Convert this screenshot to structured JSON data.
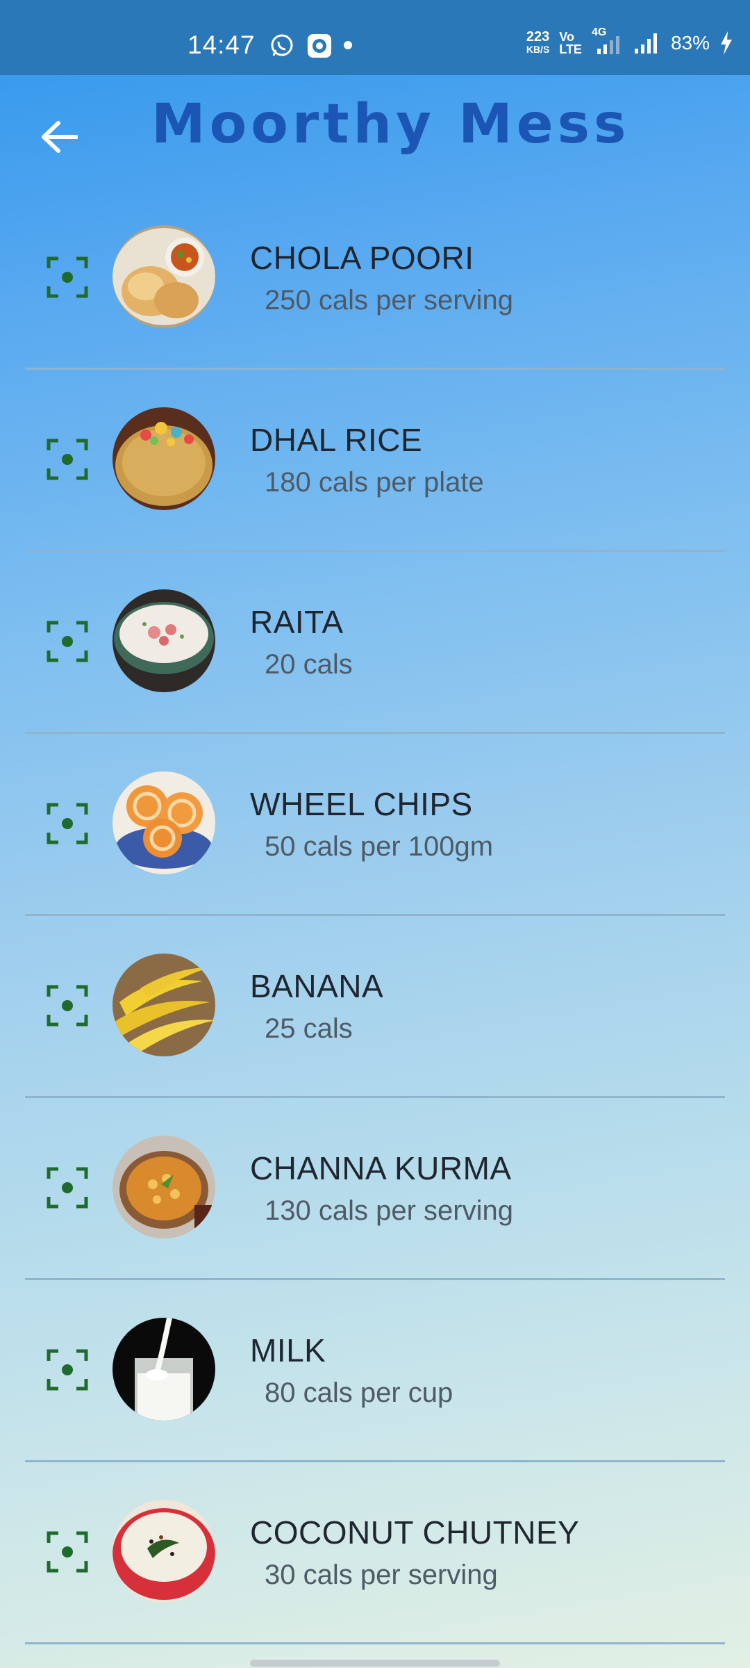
{
  "status_bar": {
    "time": "14:47",
    "net_speed_value": "223",
    "net_speed_unit": "KB/S",
    "volte_top": "Vo",
    "volte_bottom": "LTE",
    "network_type": "4G",
    "battery": "83%",
    "icons": [
      "whatsapp-icon",
      "messenger-icon",
      "notification-dot-icon",
      "signal-icon",
      "charging-icon"
    ]
  },
  "header": {
    "title": "Moorthy Mess",
    "back_icon": "arrow-left-icon"
  },
  "colors": {
    "title": "#1c56b4",
    "scan_icon": "#1f6b2e",
    "status_bar": "#2a78b8"
  },
  "food_items": [
    {
      "name": "CHOLA POORI",
      "calories": "250 cals per serving",
      "image": "chola-poori-photo",
      "icon": "scan-icon"
    },
    {
      "name": "DHAL RICE",
      "calories": "180 cals per plate",
      "image": "dhal-rice-photo",
      "icon": "scan-icon"
    },
    {
      "name": "RAITA",
      "calories": "20 cals",
      "image": "raita-photo",
      "icon": "scan-icon"
    },
    {
      "name": "WHEEL CHIPS",
      "calories": "50 cals per 100gm",
      "image": "wheel-chips-photo",
      "icon": "scan-icon"
    },
    {
      "name": "BANANA",
      "calories": "25 cals",
      "image": "banana-photo",
      "icon": "scan-icon"
    },
    {
      "name": "CHANNA KURMA",
      "calories": "130 cals per serving",
      "image": "channa-kurma-photo",
      "icon": "scan-icon"
    },
    {
      "name": "MILK",
      "calories": "80 cals per cup",
      "image": "milk-photo",
      "icon": "scan-icon"
    },
    {
      "name": "COCONUT CHUTNEY",
      "calories": "30 cals per serving",
      "image": "coconut-chutney-photo",
      "icon": "scan-icon"
    }
  ]
}
